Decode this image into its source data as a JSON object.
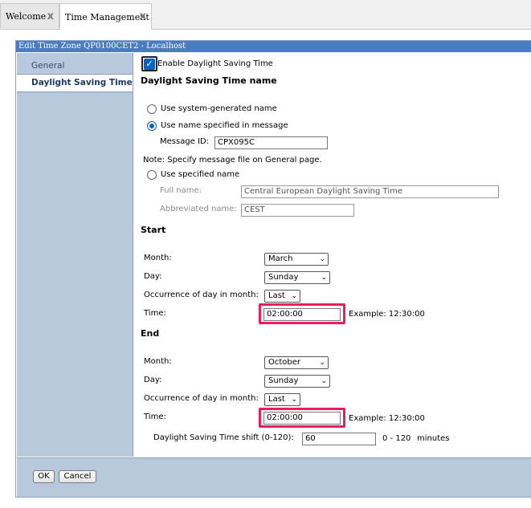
{
  "tabs": [
    {
      "label": "Welcome",
      "close": "x"
    },
    {
      "label": "Time Management",
      "close": "x"
    }
  ],
  "dialog": {
    "title": "Edit Time Zone QP0100CET2 - Localhost",
    "nav": [
      "General",
      "Daylight Saving Time"
    ],
    "enable_dst_label": "Enable Daylight Saving Time",
    "name_section": {
      "heading": "Daylight Saving Time name",
      "option_system": "Use system-generated name",
      "option_message": "Use name specified in message",
      "message_id_label": "Message ID:",
      "message_id_value": "CPX095C",
      "note": "Note: Specify message file on General page.",
      "option_specified": "Use specified name",
      "full_name_label": "Full name:",
      "full_name_value": "Central European Daylight Saving Time",
      "abbr_name_label": "Abbreviated name:",
      "abbr_name_value": "CEST"
    },
    "start": {
      "heading": "Start",
      "month_label": "Month:",
      "month_value": "March",
      "day_label": "Day:",
      "day_value": "Sunday",
      "occurrence_label": "Occurrence of day in month:",
      "occurrence_value": "Last",
      "time_label": "Time:",
      "time_value": "02:00:00",
      "example": "Example: 12:30:00"
    },
    "end": {
      "heading": "End",
      "month_label": "Month:",
      "month_value": "October",
      "day_label": "Day:",
      "day_value": "Sunday",
      "occurrence_label": "Occurrence of day in month:",
      "occurrence_value": "Last",
      "time_label": "Time:",
      "time_value": "02:00:00",
      "example": "Example: 12:30:00"
    },
    "shift": {
      "label": "Daylight Saving Time shift (0-120):",
      "value": "60",
      "range": "0 - 120",
      "unit": "minutes"
    },
    "buttons": {
      "ok": "OK",
      "cancel": "Cancel"
    }
  },
  "colors": {
    "accent": "#0a62c7",
    "highlight": "#ef1b5c",
    "sidebar": "#b9c9dd",
    "titlebar": "#4a7cc0"
  },
  "icons": {
    "checkbox": "check-icon",
    "chevron": "chevron-down-icon",
    "close": "close-icon"
  }
}
